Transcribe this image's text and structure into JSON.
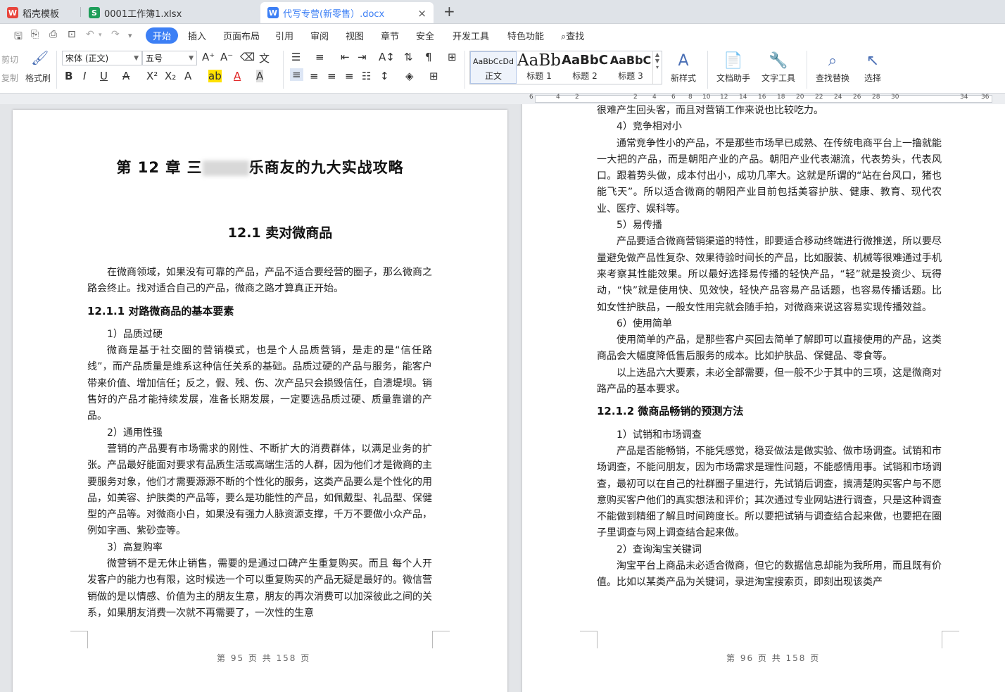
{
  "tabs": [
    {
      "label": "稻壳模板",
      "icon": "wps-logo-icon"
    },
    {
      "label": "0001工作簿1.xlsx",
      "icon": "spreadsheet-icon"
    },
    {
      "label": "代写专营(新零售）.docx",
      "icon": "word-doc-icon"
    }
  ],
  "new_tab": "+",
  "close_tab": "×",
  "menu": [
    "开始",
    "插入",
    "页面布局",
    "引用",
    "审阅",
    "视图",
    "章节",
    "安全",
    "开发工具",
    "特色功能",
    "查找"
  ],
  "ribbon": {
    "cut": "剪切",
    "copy": "复制",
    "format_painter": "格式刷",
    "font_name": "宋体 (正文)",
    "font_size": "五号",
    "styles": [
      {
        "sample": "AaBbCcDd",
        "name": "正文"
      },
      {
        "sample": "AaBb",
        "name": "标题 1"
      },
      {
        "sample": "AaBbC",
        "name": "标题 2"
      },
      {
        "sample": "AaBbC",
        "name": "标题 3"
      }
    ],
    "new_style": "新样式",
    "doc_assistant": "文档助手",
    "text_tools": "文字工具",
    "find_replace": "查找替换",
    "select": "选择"
  },
  "ruler_numbers": [
    "6",
    "4",
    "2",
    "2",
    "4",
    "6",
    "8",
    "10",
    "12",
    "14",
    "16",
    "18",
    "20",
    "22",
    "24",
    "26",
    "28",
    "30",
    "34",
    "36"
  ],
  "left_page": {
    "chapter_title_pre": "第 12 章  三",
    "chapter_title_post": "乐商友的九大实战攻略",
    "section_title": "12.1  卖对微商品",
    "intro": "在微商领域，如果没有可靠的产品，产品不适合要经营的圈子，那么微商之路会终止。找对适合自己的产品，微商之路才算真正开始。",
    "sub_title": "12.1.1  对路微商品的基本要素",
    "p1_title": "1）品质过硬",
    "p1": "微商是基于社交圈的营销模式，也是个人品质营销，是走的是“信任路线”，而产品质量是维系这种信任关系的基础。品质过硬的产品与服务，能客户带来价值、增加信任；反之，假、残、伤、次产品只会损毁信任，自溃堤坝。销售好的产品才能持续发展，准备长期发展，一定要选品质过硬、质量靠谱的产品。",
    "p2_title": "2）通用性强",
    "p2": "营销的产品要有市场需求的刚性、不断扩大的消费群体，以满足业务的扩张。产品最好能面对要求有品质生活或高端生活的人群，因为他们才是微商的主要服务对象，他们才需要源源不断的个性化的服务，这类产品要么是个性化的用品，如美容、护肤类的产品等，要么是功能性的产品，如佩戴型、礼品型、保健型的产品等。对微商小白，如果没有强力人脉资源支撑，千万不要做小众产品，例如字画、紫砂壶等。",
    "p3_title": "3）高复购率",
    "p3": "微营销不是无休止销售，需要的是通过口碑产生重复购买。而且 每个人开发客户的能力也有限，这时候选一个可以重复购买的产品无疑是最好的。微信营销做的是以情感、价值为主的朋友生意，朋友的再次消费可以加深彼此之间的关系，如果朋友消费一次就不再需要了，一次性的生意",
    "footer": "第 95 页 共 158 页"
  },
  "right_page": {
    "top_line": "很难产生回头客，而且对营销工作来说也比较吃力。",
    "p4_title": "4）竞争相对小",
    "p4": "通常竞争性小的产品，不是那些市场早已成熟、在传统电商平台上一撸就能一大把的产品，而是朝阳产业的产品。朝阳产业代表潮流，代表势头，代表风口。跟着势头做，成本付出小，成功几率大。这就是所谓的“站在台风口，猪也能飞天”。所以适合微商的朝阳产业目前包括美容护肤、健康、教育、现代农业、医疗、娱科等。",
    "p5_title": "5）易传播",
    "p5": "产品要适合微商营销渠道的特性，即要适合移动终端进行微推送，所以要尽量避免做产品性复杂、效果待验时间长的产品，比如服装、机械等很难通过手机来考察其性能效果。所以最好选择易传播的轻快产品，“轻”就是投资少、玩得动，“快”就是使用快、见效快，轻快产品容易产品话题，也容易传播话题。比如女性护肤品，一般女性用完就会随手拍，对微商来说这容易实现传播效益。",
    "p6_title": "6）使用简单",
    "p6": "使用简单的产品，是那些客户买回去简单了解即可以直接使用的产品，这类商品会大幅度降低售后服务的成本。比如护肤品、保健品、零食等。",
    "summary": "以上选品六大要素，未必全部需要，但一般不少于其中的三项，这是微商对路产品的基本要求。",
    "sub_title": "12.1.2  微商品畅销的预测方法",
    "q1_title": "1）试销和市场调查",
    "q1": "产品是否能畅销，不能凭感觉，稳妥做法是做实验、做市场调查。试销和市场调查，不能问朋友，因为市场需求是理性问题，不能感情用事。试销和市场调查，最初可以在自己的社群圈子里进行，先试销后调查，搞清楚购买客户与不愿意购买客户他们的真实想法和评价；其次通过专业网站进行调查，只是这种调查不能做到精细了解且时间跨度长。所以要把试销与调查结合起来做，也要把在圈子里调查与网上调查结合起来做。",
    "q2_title": "2）查询淘宝关键词",
    "q2": "淘宝平台上商品未必适合微商，但它的数据信息却能为我所用，而且既有价值。比如以某类产品为关键词，录进淘宝搜索页，即刻出现该类产",
    "footer": "第 96 页 共 158 页"
  }
}
